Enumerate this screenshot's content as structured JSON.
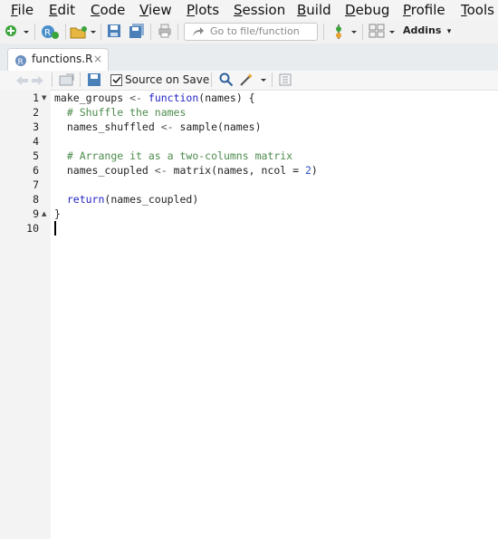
{
  "menu": [
    "File",
    "Edit",
    "Code",
    "View",
    "Plots",
    "Session",
    "Build",
    "Debug",
    "Profile",
    "Tools"
  ],
  "menu_underline": [
    "F",
    "E",
    "C",
    "V",
    "P",
    "S",
    "B",
    "D",
    "P",
    "T"
  ],
  "toolbar": {
    "goto_placeholder": "Go to file/function",
    "addins_label": "Addins"
  },
  "tab": {
    "filename": "functions.R",
    "close": "×"
  },
  "editor_toolbar": {
    "source_on_save_label": "Source on Save",
    "source_on_save_checked": true
  },
  "editor": {
    "line_numbers": [
      "1",
      "2",
      "3",
      "4",
      "5",
      "6",
      "7",
      "8",
      "9",
      "10"
    ],
    "lines": [
      {
        "num": "1",
        "text": "make_groups <- function(names) {"
      },
      {
        "num": "2",
        "text": "  # Shuffle the names"
      },
      {
        "num": "3",
        "text": "  names_shuffled <- sample(names)"
      },
      {
        "num": "4",
        "text": ""
      },
      {
        "num": "5",
        "text": "  # Arrange it as a two-columns matrix"
      },
      {
        "num": "6",
        "text": "  names_coupled <- matrix(names, ncol = 2)"
      },
      {
        "num": "7",
        "text": ""
      },
      {
        "num": "8",
        "text": "  return(names_coupled)"
      },
      {
        "num": "9",
        "text": "}"
      },
      {
        "num": "10",
        "text": ""
      }
    ]
  },
  "colors": {
    "keyword": "#2323c4",
    "comment": "#4c8b4c",
    "number": "#2b55c8",
    "gutter": "#f3f3f3"
  }
}
